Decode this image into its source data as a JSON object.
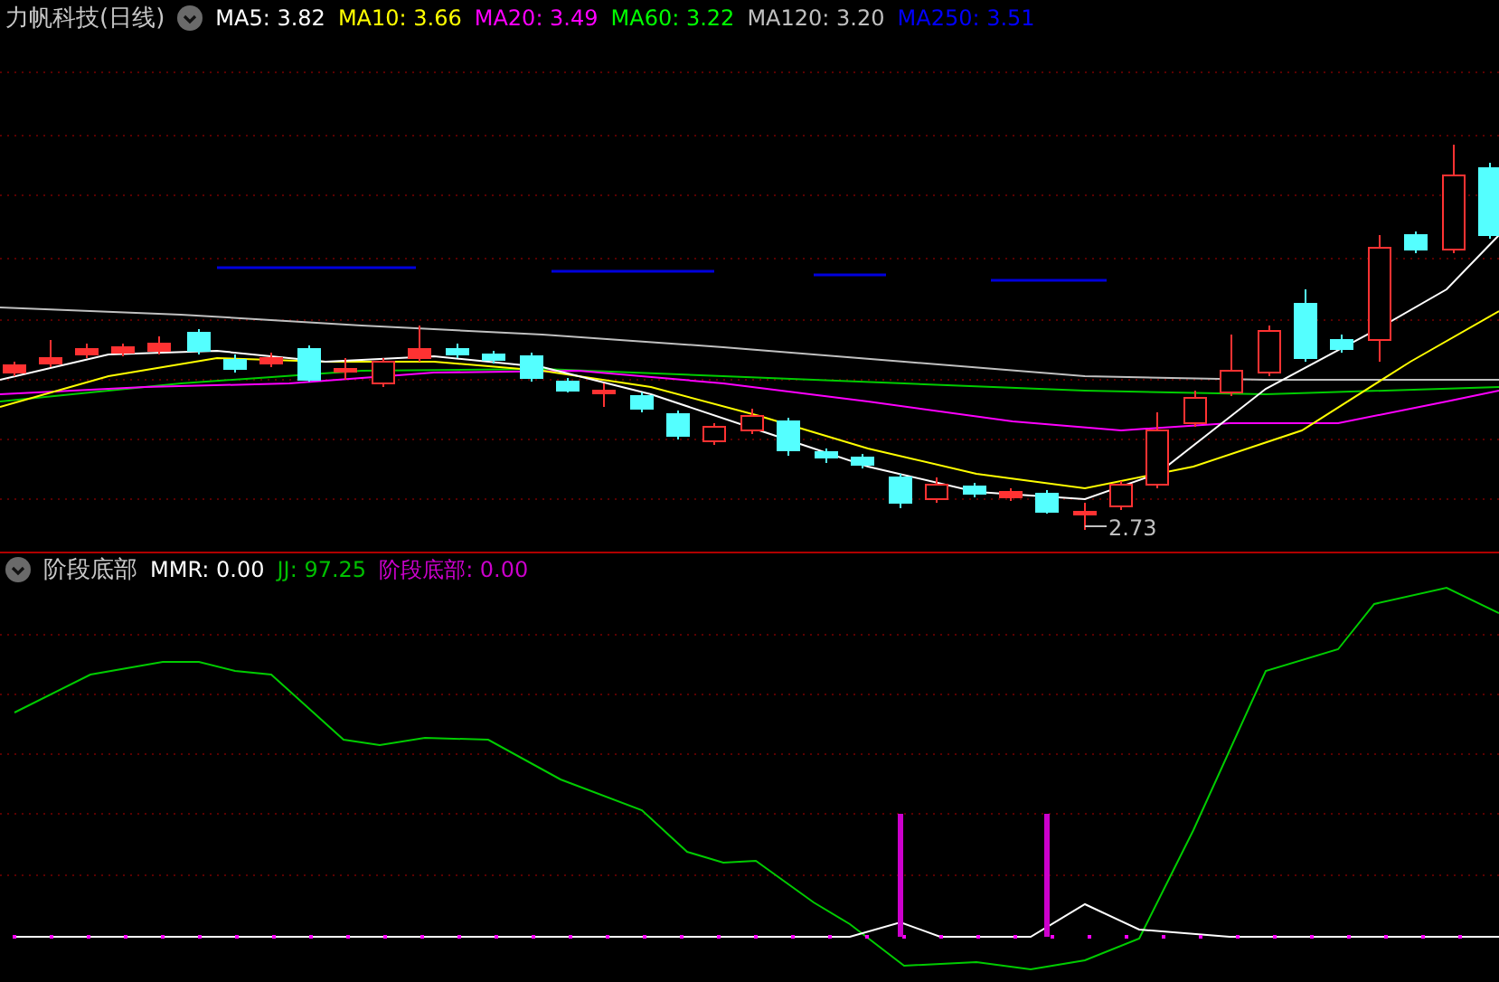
{
  "main_chart": {
    "title": "力帆科技(日线)",
    "indicators": [
      {
        "label": "MA5: 3.82",
        "color": "#ffffff"
      },
      {
        "label": "MA10: 3.66",
        "color": "#ffff00"
      },
      {
        "label": "MA20: 3.49",
        "color": "#ff00ff"
      },
      {
        "label": "MA60: 3.22",
        "color": "#00ff00"
      },
      {
        "label": "MA120: 3.20",
        "color": "#c0c0c0"
      },
      {
        "label": "MA250: 3.51",
        "color": "#0000ff"
      }
    ],
    "low_marker": "2.73"
  },
  "sub_chart": {
    "title": "阶段底部",
    "indicators": [
      {
        "label": "MMR: 0.00",
        "color": "#ffffff"
      },
      {
        "label": "JJ: 97.25",
        "color": "#00c000"
      },
      {
        "label": "阶段底部: 0.00",
        "color": "#cc00cc"
      }
    ]
  }
}
